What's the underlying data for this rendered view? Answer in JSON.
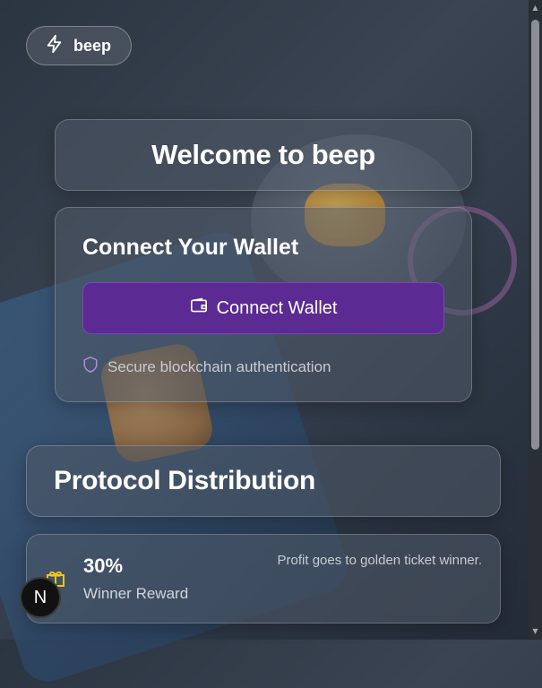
{
  "brand": {
    "name": "beep",
    "icon": "lightning-icon"
  },
  "welcome": {
    "title": "Welcome to beep"
  },
  "connect": {
    "title": "Connect Your Wallet",
    "button_label": "Connect Wallet",
    "button_icon": "wallet-icon",
    "secure_text": "Secure blockchain authentication",
    "secure_icon": "shield-icon"
  },
  "protocol": {
    "title": "Protocol Distribution"
  },
  "reward": {
    "percent": "30%",
    "label": "Winner Reward",
    "description": "Profit goes to golden ticket winner.",
    "icon": "gift-icon"
  },
  "badge": {
    "letter": "N"
  },
  "colors": {
    "accent": "#5b2a92",
    "gift": "#f5c518",
    "shield": "#b48be0"
  }
}
